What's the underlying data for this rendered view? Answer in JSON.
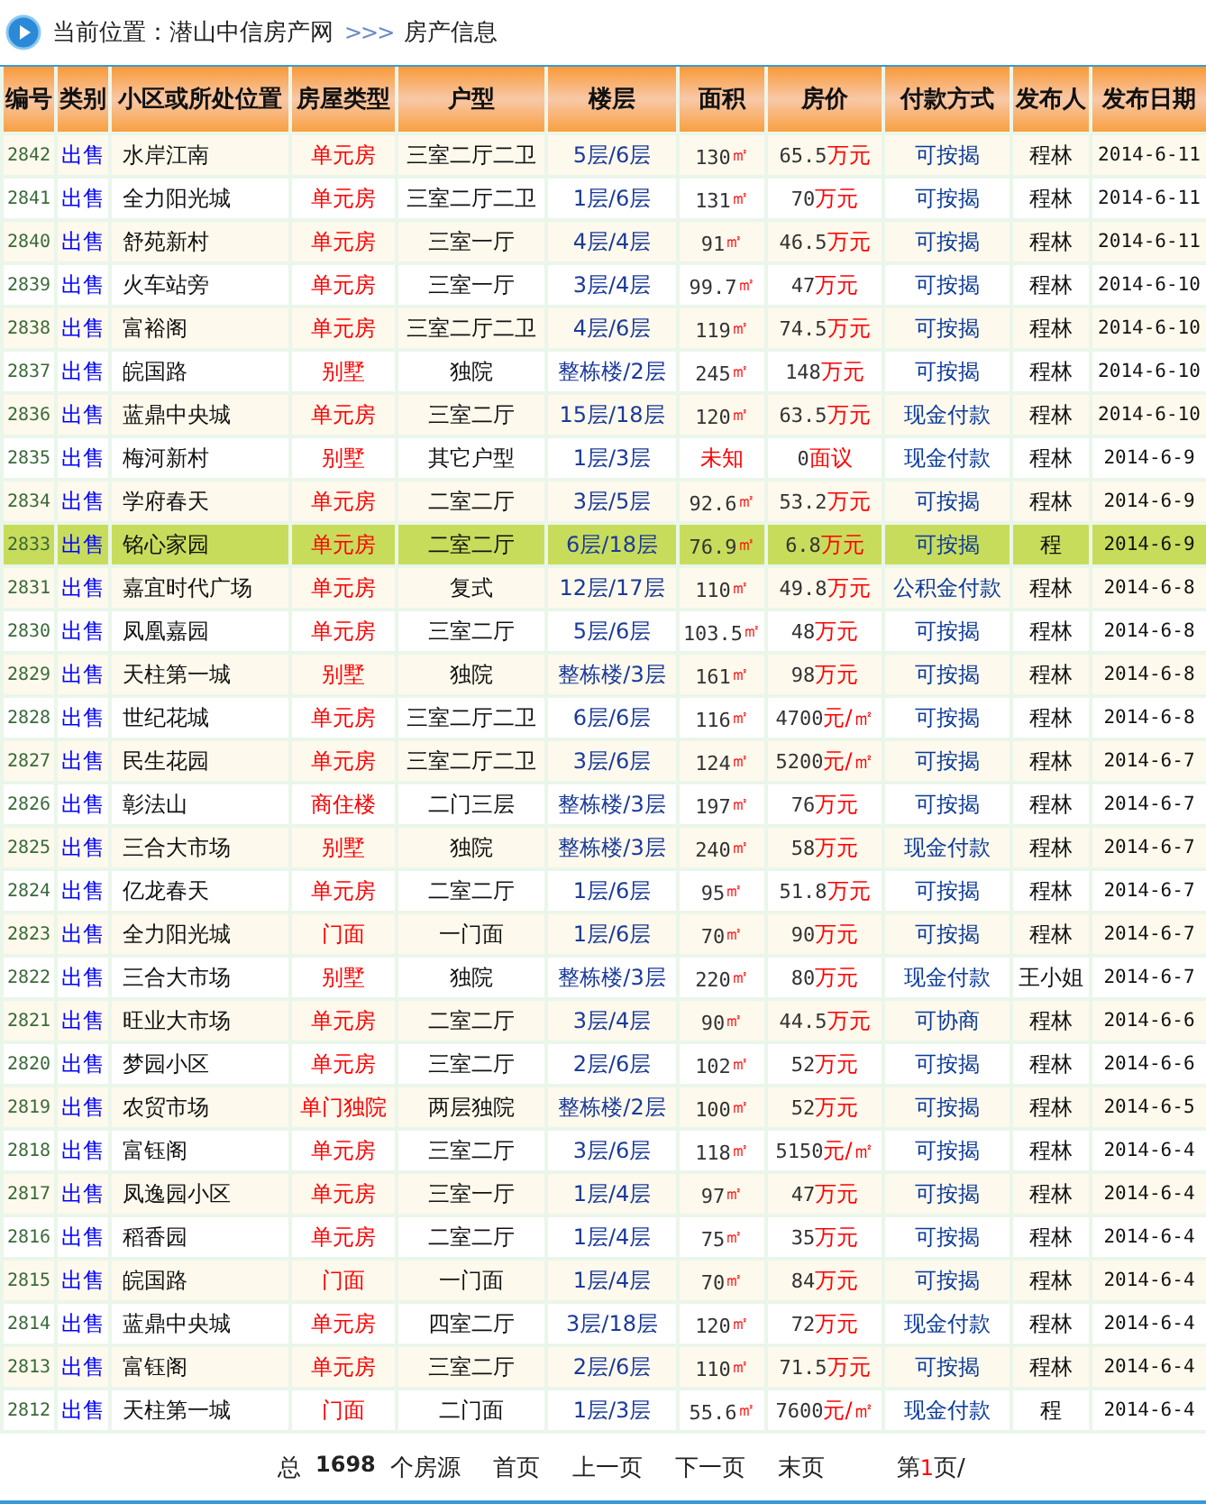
{
  "breadcrumb": {
    "label": "当前位置：潜山中信房产网",
    "separator": ">>>",
    "current": "房产信息"
  },
  "table": {
    "columns": [
      "编号",
      "类别",
      "小区或所处位置",
      "房屋类型",
      "户型",
      "楼层",
      "面积",
      "房价",
      "付款方式",
      "发布人",
      "发布日期"
    ],
    "rows": [
      {
        "id": "2842",
        "category": "出售",
        "name": "水岸江南",
        "type": "单元房",
        "layout": "三室二厅二卫",
        "floor": "5层/6层",
        "area": {
          "amount": "130",
          "unit": "㎡"
        },
        "price": {
          "amount": "65.5",
          "unit": "万元"
        },
        "payment": "可按揭",
        "publisher": "程林",
        "date": "2014-6-11",
        "selected": false
      },
      {
        "id": "2841",
        "category": "出售",
        "name": "全力阳光城",
        "type": "单元房",
        "layout": "三室二厅二卫",
        "floor": "1层/6层",
        "area": {
          "amount": "131",
          "unit": "㎡"
        },
        "price": {
          "amount": "70",
          "unit": "万元"
        },
        "payment": "可按揭",
        "publisher": "程林",
        "date": "2014-6-11",
        "selected": false
      },
      {
        "id": "2840",
        "category": "出售",
        "name": "舒苑新村",
        "type": "单元房",
        "layout": "三室一厅",
        "floor": "4层/4层",
        "area": {
          "amount": "91",
          "unit": "㎡"
        },
        "price": {
          "amount": "46.5",
          "unit": "万元"
        },
        "payment": "可按揭",
        "publisher": "程林",
        "date": "2014-6-11",
        "selected": false
      },
      {
        "id": "2839",
        "category": "出售",
        "name": "火车站旁",
        "type": "单元房",
        "layout": "三室一厅",
        "floor": "3层/4层",
        "area": {
          "amount": "99.7",
          "unit": "㎡"
        },
        "price": {
          "amount": "47",
          "unit": "万元"
        },
        "payment": "可按揭",
        "publisher": "程林",
        "date": "2014-6-10",
        "selected": false
      },
      {
        "id": "2838",
        "category": "出售",
        "name": "富裕阁",
        "type": "单元房",
        "layout": "三室二厅二卫",
        "floor": "4层/6层",
        "area": {
          "amount": "119",
          "unit": "㎡"
        },
        "price": {
          "amount": "74.5",
          "unit": "万元"
        },
        "payment": "可按揭",
        "publisher": "程林",
        "date": "2014-6-10",
        "selected": false
      },
      {
        "id": "2837",
        "category": "出售",
        "name": "皖国路",
        "type": "别墅",
        "layout": "独院",
        "floor": "整栋楼/2层",
        "area": {
          "amount": "245",
          "unit": "㎡"
        },
        "price": {
          "amount": "148",
          "unit": "万元"
        },
        "payment": "可按揭",
        "publisher": "程林",
        "date": "2014-6-10",
        "selected": false
      },
      {
        "id": "2836",
        "category": "出售",
        "name": "蓝鼎中央城",
        "type": "单元房",
        "layout": "三室二厅",
        "floor": "15层/18层",
        "area": {
          "amount": "120",
          "unit": "㎡"
        },
        "price": {
          "amount": "63.5",
          "unit": "万元"
        },
        "payment": "现金付款",
        "publisher": "程林",
        "date": "2014-6-10",
        "selected": false
      },
      {
        "id": "2835",
        "category": "出售",
        "name": "梅河新村",
        "type": "别墅",
        "layout": "其它户型",
        "floor": "1层/3层",
        "area": {
          "unit": "未知"
        },
        "price": {
          "amount": "0",
          "unit": "面议"
        },
        "payment": "现金付款",
        "publisher": "程林",
        "date": "2014-6-9",
        "selected": false
      },
      {
        "id": "2834",
        "category": "出售",
        "name": "学府春天",
        "type": "单元房",
        "layout": "二室二厅",
        "floor": "3层/5层",
        "area": {
          "amount": "92.6",
          "unit": "㎡"
        },
        "price": {
          "amount": "53.2",
          "unit": "万元"
        },
        "payment": "可按揭",
        "publisher": "程林",
        "date": "2014-6-9",
        "selected": false
      },
      {
        "id": "2833",
        "category": "出售",
        "name": "铭心家园",
        "type": "单元房",
        "layout": "二室二厅",
        "floor": "6层/18层",
        "area": {
          "amount": "76.9",
          "unit": "㎡"
        },
        "price": {
          "amount": "6.8",
          "unit": "万元"
        },
        "payment": "可按揭",
        "publisher": "程",
        "date": "2014-6-9",
        "selected": true
      },
      {
        "id": "2831",
        "category": "出售",
        "name": "嘉宜时代广场",
        "type": "单元房",
        "layout": "复式",
        "floor": "12层/17层",
        "area": {
          "amount": "110",
          "unit": "㎡"
        },
        "price": {
          "amount": "49.8",
          "unit": "万元"
        },
        "payment": "公积金付款",
        "publisher": "程林",
        "date": "2014-6-8",
        "selected": false
      },
      {
        "id": "2830",
        "category": "出售",
        "name": "凤凰嘉园",
        "type": "单元房",
        "layout": "三室二厅",
        "floor": "5层/6层",
        "area": {
          "amount": "103.5",
          "unit": "㎡"
        },
        "price": {
          "amount": "48",
          "unit": "万元"
        },
        "payment": "可按揭",
        "publisher": "程林",
        "date": "2014-6-8",
        "selected": false
      },
      {
        "id": "2829",
        "category": "出售",
        "name": "天柱第一城",
        "type": "别墅",
        "layout": "独院",
        "floor": "整栋楼/3层",
        "area": {
          "amount": "161",
          "unit": "㎡"
        },
        "price": {
          "amount": "98",
          "unit": "万元"
        },
        "payment": "可按揭",
        "publisher": "程林",
        "date": "2014-6-8",
        "selected": false
      },
      {
        "id": "2828",
        "category": "出售",
        "name": "世纪花城",
        "type": "单元房",
        "layout": "三室二厅二卫",
        "floor": "6层/6层",
        "area": {
          "amount": "116",
          "unit": "㎡"
        },
        "price": {
          "amount": "4700",
          "unit": "元/㎡"
        },
        "payment": "可按揭",
        "publisher": "程林",
        "date": "2014-6-8",
        "selected": false
      },
      {
        "id": "2827",
        "category": "出售",
        "name": "民生花园",
        "type": "单元房",
        "layout": "三室二厅二卫",
        "floor": "3层/6层",
        "area": {
          "amount": "124",
          "unit": "㎡"
        },
        "price": {
          "amount": "5200",
          "unit": "元/㎡"
        },
        "payment": "可按揭",
        "publisher": "程林",
        "date": "2014-6-7",
        "selected": false
      },
      {
        "id": "2826",
        "category": "出售",
        "name": "彰法山",
        "type": "商住楼",
        "layout": "二门三层",
        "floor": "整栋楼/3层",
        "area": {
          "amount": "197",
          "unit": "㎡"
        },
        "price": {
          "amount": "76",
          "unit": "万元"
        },
        "payment": "可按揭",
        "publisher": "程林",
        "date": "2014-6-7",
        "selected": false
      },
      {
        "id": "2825",
        "category": "出售",
        "name": "三合大市场",
        "type": "别墅",
        "layout": "独院",
        "floor": "整栋楼/3层",
        "area": {
          "amount": "240",
          "unit": "㎡"
        },
        "price": {
          "amount": "58",
          "unit": "万元"
        },
        "payment": "现金付款",
        "publisher": "程林",
        "date": "2014-6-7",
        "selected": false
      },
      {
        "id": "2824",
        "category": "出售",
        "name": "亿龙春天",
        "type": "单元房",
        "layout": "二室二厅",
        "floor": "1层/6层",
        "area": {
          "amount": "95",
          "unit": "㎡"
        },
        "price": {
          "amount": "51.8",
          "unit": "万元"
        },
        "payment": "可按揭",
        "publisher": "程林",
        "date": "2014-6-7",
        "selected": false
      },
      {
        "id": "2823",
        "category": "出售",
        "name": "全力阳光城",
        "type": "门面",
        "layout": "一门面",
        "floor": "1层/6层",
        "area": {
          "amount": "70",
          "unit": "㎡"
        },
        "price": {
          "amount": "90",
          "unit": "万元"
        },
        "payment": "可按揭",
        "publisher": "程林",
        "date": "2014-6-7",
        "selected": false
      },
      {
        "id": "2822",
        "category": "出售",
        "name": "三合大市场",
        "type": "别墅",
        "layout": "独院",
        "floor": "整栋楼/3层",
        "area": {
          "amount": "220",
          "unit": "㎡"
        },
        "price": {
          "amount": "80",
          "unit": "万元"
        },
        "payment": "现金付款",
        "publisher": "王小姐",
        "date": "2014-6-7",
        "selected": false
      },
      {
        "id": "2821",
        "category": "出售",
        "name": "旺业大市场",
        "type": "单元房",
        "layout": "二室二厅",
        "floor": "3层/4层",
        "area": {
          "amount": "90",
          "unit": "㎡"
        },
        "price": {
          "amount": "44.5",
          "unit": "万元"
        },
        "payment": "可协商",
        "publisher": "程林",
        "date": "2014-6-6",
        "selected": false
      },
      {
        "id": "2820",
        "category": "出售",
        "name": "梦园小区",
        "type": "单元房",
        "layout": "三室二厅",
        "floor": "2层/6层",
        "area": {
          "amount": "102",
          "unit": "㎡"
        },
        "price": {
          "amount": "52",
          "unit": "万元"
        },
        "payment": "可按揭",
        "publisher": "程林",
        "date": "2014-6-6",
        "selected": false
      },
      {
        "id": "2819",
        "category": "出售",
        "name": "农贸市场",
        "type": "单门独院",
        "layout": "两层独院",
        "floor": "整栋楼/2层",
        "area": {
          "amount": "100",
          "unit": "㎡"
        },
        "price": {
          "amount": "52",
          "unit": "万元"
        },
        "payment": "可按揭",
        "publisher": "程林",
        "date": "2014-6-5",
        "selected": false
      },
      {
        "id": "2818",
        "category": "出售",
        "name": "富钰阁",
        "type": "单元房",
        "layout": "三室二厅",
        "floor": "3层/6层",
        "area": {
          "amount": "118",
          "unit": "㎡"
        },
        "price": {
          "amount": "5150",
          "unit": "元/㎡"
        },
        "payment": "可按揭",
        "publisher": "程林",
        "date": "2014-6-4",
        "selected": false
      },
      {
        "id": "2817",
        "category": "出售",
        "name": "凤逸园小区",
        "type": "单元房",
        "layout": "三室一厅",
        "floor": "1层/4层",
        "area": {
          "amount": "97",
          "unit": "㎡"
        },
        "price": {
          "amount": "47",
          "unit": "万元"
        },
        "payment": "可按揭",
        "publisher": "程林",
        "date": "2014-6-4",
        "selected": false
      },
      {
        "id": "2816",
        "category": "出售",
        "name": "稻香园",
        "type": "单元房",
        "layout": "二室二厅",
        "floor": "1层/4层",
        "area": {
          "amount": "75",
          "unit": "㎡"
        },
        "price": {
          "amount": "35",
          "unit": "万元"
        },
        "payment": "可按揭",
        "publisher": "程林",
        "date": "2014-6-4",
        "selected": false
      },
      {
        "id": "2815",
        "category": "出售",
        "name": "皖国路",
        "type": "门面",
        "layout": "一门面",
        "floor": "1层/4层",
        "area": {
          "amount": "70",
          "unit": "㎡"
        },
        "price": {
          "amount": "84",
          "unit": "万元"
        },
        "payment": "可按揭",
        "publisher": "程林",
        "date": "2014-6-4",
        "selected": false
      },
      {
        "id": "2814",
        "category": "出售",
        "name": "蓝鼎中央城",
        "type": "单元房",
        "layout": "四室二厅",
        "floor": "3层/18层",
        "area": {
          "amount": "120",
          "unit": "㎡"
        },
        "price": {
          "amount": "72",
          "unit": "万元"
        },
        "payment": "现金付款",
        "publisher": "程林",
        "date": "2014-6-4",
        "selected": false
      },
      {
        "id": "2813",
        "category": "出售",
        "name": "富钰阁",
        "type": "单元房",
        "layout": "三室二厅",
        "floor": "2层/6层",
        "area": {
          "amount": "110",
          "unit": "㎡"
        },
        "price": {
          "amount": "71.5",
          "unit": "万元"
        },
        "payment": "可按揭",
        "publisher": "程林",
        "date": "2014-6-4",
        "selected": false
      },
      {
        "id": "2812",
        "category": "出售",
        "name": "天柱第一城",
        "type": "门面",
        "layout": "二门面",
        "floor": "1层/3层",
        "area": {
          "amount": "55.6",
          "unit": "㎡"
        },
        "price": {
          "amount": "7600",
          "unit": "元/㎡"
        },
        "payment": "现金付款",
        "publisher": "程",
        "date": "2014-6-4",
        "selected": false
      }
    ]
  },
  "footer": {
    "total_prefix": "总",
    "total": "1698",
    "total_suffix": "个房源",
    "links": [
      "首页",
      "上一页",
      "下一页",
      "末页"
    ],
    "page_prefix": "第",
    "current_page": "1",
    "page_suffix": "页/"
  }
}
